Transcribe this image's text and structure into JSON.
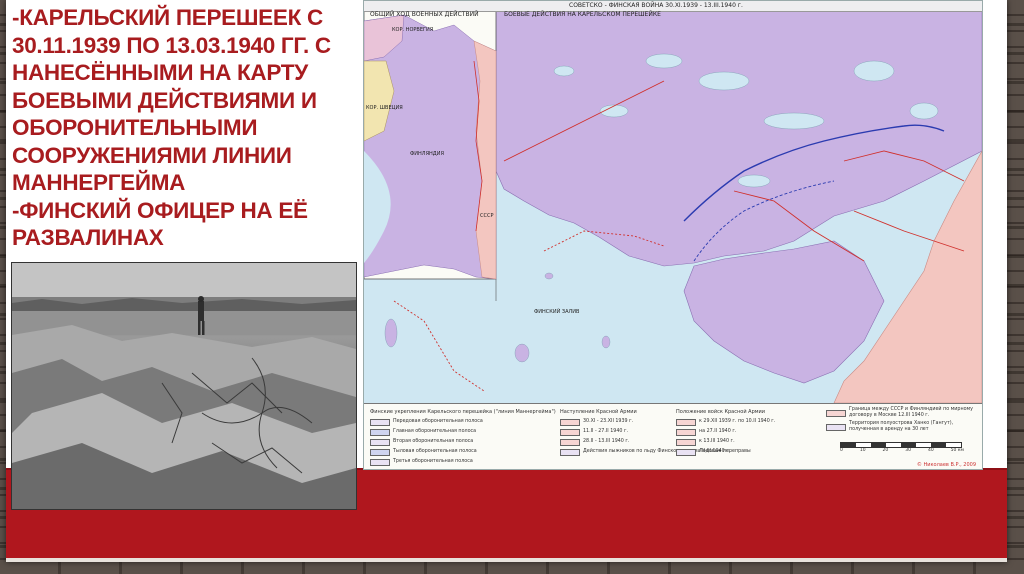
{
  "slide": {
    "title_lines": [
      "-КАРЕЛЬСКИЙ ПЕРЕШЕЕК С",
      "30.11.1939 ПО 13.03.1940 ГГ. С",
      "НАНЕСЁННЫМИ НА КАРТУ",
      "БОЕВЫМИ ДЕЙСТВИЯМИ И",
      "ОБОРОНИТЕЛЬНЫМИ",
      "СООРУЖЕНИЯМИ ЛИНИИ",
      "МАННЕРГЕЙМА",
      "-ФИНСКИЙ ОФИЦЕР НА ЕЁ",
      "РАЗВАЛИНАХ"
    ],
    "colors": {
      "title": "#a81c1f",
      "band": "#b0171e",
      "map_finland": "#c9b3e3",
      "map_ussr": "#f3c6c0",
      "map_sea": "#cfe7f2"
    }
  },
  "map": {
    "header_title": "СОВЕТСКО - ФИНСКАЯ ВОЙНА 30.ХI.1939 - 13.III.1940 г.",
    "inset_left_title": "ОБЩИЙ ХОД ВОЕННЫХ ДЕЙСТВИЙ",
    "inset_right_title": "БОЕВЫЕ ДЕЙСТВИЯ НА КАРЕЛЬСКОМ ПЕРЕШЕЙКЕ",
    "inset_labels": {
      "norway": "КОР. НОРВЕГИЯ",
      "sweden": "КОР. ШВЕЦИЯ",
      "finland": "ФИНЛЯНДИЯ",
      "ussr": "СССР"
    },
    "sea_label": "ФИНСКИЙ ЗАЛИВ",
    "legend": {
      "col1_head": "Финские укрепления Карельского перешейка (\"линия Маннергейма\")",
      "col1_items": [
        "Передовая оборонительная полоса",
        "Главная оборонительная полоса",
        "Вторая оборонительная полоса",
        "Тыловая оборонительная полоса",
        "Третья оборонительная полоса"
      ],
      "col2_head": "Наступление Красной Армии",
      "col2_items": [
        "30.ХI - 23.ХII 1939 г.",
        "11.II - 27.II 1940 г.",
        "28.II - 13.III 1940 г.",
        "Действия лыжников по льду Финского залива II-III.1940 г."
      ],
      "col3_head": "Положение войск Красной Армии",
      "col3_items": [
        "к 29.ХII 1939 г. по 10.II 1940 г.",
        "на 27.II 1940 г.",
        "к 13.III 1940 г.",
        "Ледовые переправы"
      ],
      "col4_items": [
        "Граница между СССР и Финляндией по мирному договору в Москве 12.III 1940 г.",
        "Территория полуострова Ханко (Гангут), полученная в аренду на 30 лет"
      ],
      "scale_labels": [
        "0",
        "10",
        "20",
        "30",
        "40",
        "50 км"
      ],
      "author": "© Николаев В.Р., 2009"
    }
  }
}
